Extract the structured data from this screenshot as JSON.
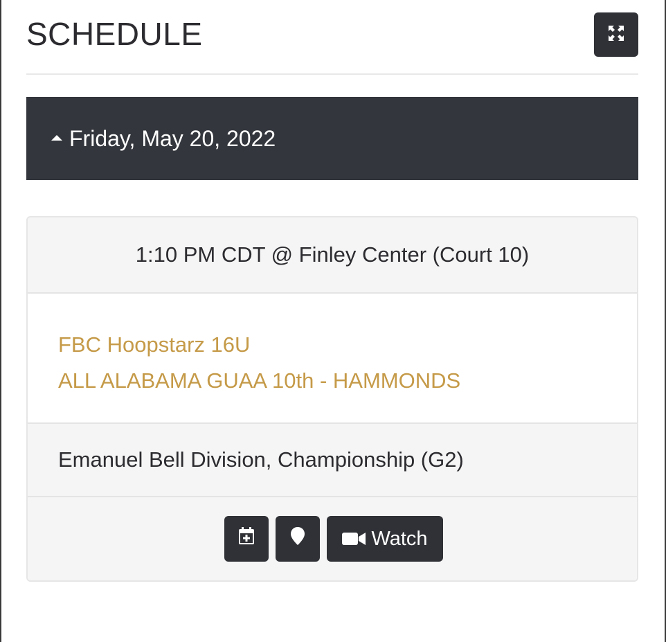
{
  "header": {
    "title": "SCHEDULE",
    "expand_icon": "expand-arrows-icon"
  },
  "day": {
    "label": "Friday, May 20, 2022",
    "toggle_icon": "caret-up-icon"
  },
  "game": {
    "time_location": "1:10 PM CDT @ Finley Center (Court 10)",
    "teams": [
      "FBC Hoopstarz 16U",
      "ALL ALABAMA GUAA 10th - HAMMONDS"
    ],
    "division": "Emanuel Bell Division, Championship (G2)",
    "actions": {
      "calendar_icon": "calendar-add-icon",
      "location_icon": "map-pin-icon",
      "watch_icon": "video-camera-icon",
      "watch_label": "Watch"
    }
  },
  "colors": {
    "dark": "#33363c",
    "team_link": "#c59a48",
    "card_bg": "#f5f5f5"
  }
}
